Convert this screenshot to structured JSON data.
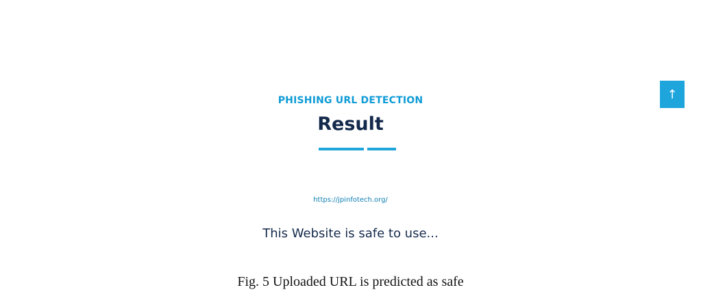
{
  "page": {
    "eyebrow": "PHISHING URL DETECTION",
    "title": "Result",
    "url": "https://jpinfotech.org/",
    "verdict": "This Website is safe to use..."
  },
  "scroll_top": {
    "icon": "arrow-up-icon",
    "glyph": "↑"
  },
  "caption": "Fig. 5 Uploaded URL is predicted as safe",
  "colors": {
    "accent": "#1ea5dc",
    "heading": "#13294b"
  }
}
